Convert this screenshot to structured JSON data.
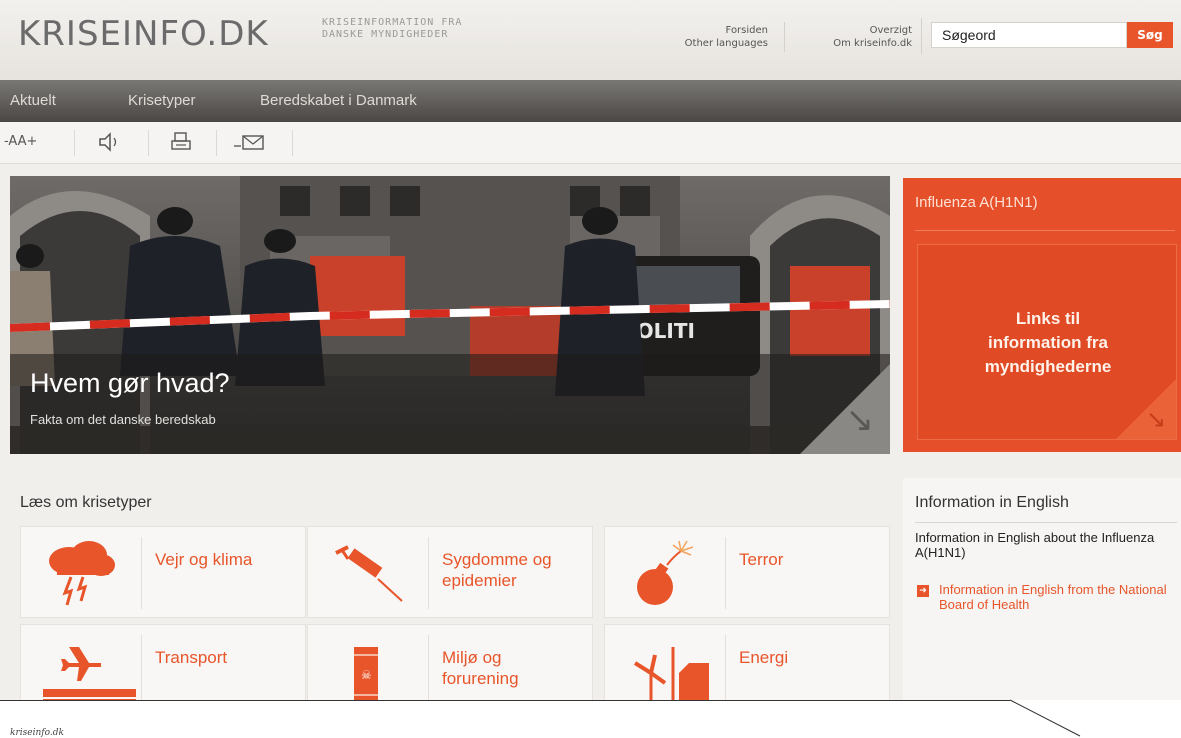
{
  "header": {
    "logo": "KRISEINFO.DK",
    "tagline_line1": "KRISEINFORMATION FRA",
    "tagline_line2": "DANSKE MYNDIGHEDER",
    "links": {
      "forsiden": "Forsiden",
      "other_languages": "Other languages",
      "overzigt": "Overzigt",
      "om": "Om kriseinfo.dk"
    },
    "search": {
      "value": "Søgeord",
      "button": "Søg"
    }
  },
  "nav": {
    "items": [
      "Aktuelt",
      "Krisetyper",
      "Beredskabet i Danmark"
    ]
  },
  "toolbar": {
    "text_size": "-AA+",
    "listen_icon": "speaker-icon",
    "print_icon": "print-icon",
    "email_icon": "email-icon"
  },
  "hero": {
    "title": "Hvem gør hvad?",
    "subtitle": "Fakta om det danske beredskab",
    "van_text": "POLITI"
  },
  "promo": {
    "title": "Influenza A(H1N1)",
    "body_line1": "Links til",
    "body_line2": "information fra",
    "body_line3": "myndighederne"
  },
  "crisis": {
    "heading": "Læs om krisetyper",
    "tiles": [
      {
        "line1": "Vejr og klima",
        "line2": "",
        "icon": "storm-cloud-icon"
      },
      {
        "line1": "Sygdomme og",
        "line2": "epidemier",
        "icon": "syringe-icon"
      },
      {
        "line1": "Terror",
        "line2": "",
        "icon": "bomb-icon"
      },
      {
        "line1": "Transport",
        "line2": "",
        "icon": "airplane-train-icon"
      },
      {
        "line1": "Miljø og",
        "line2": "forurening",
        "icon": "toxic-barrel-icon"
      },
      {
        "line1": "Energi",
        "line2": "",
        "icon": "wind-turbine-icon"
      }
    ]
  },
  "english": {
    "heading": "Information in English",
    "text": "Information in English about the Influenza A(H1N1)",
    "link": "Information in English from the National Board of Health"
  },
  "caption": "kriseinfo.dk",
  "colors": {
    "accent": "#e8552a",
    "nav_bg": "#4a4744",
    "page_bg": "#f1efec"
  }
}
